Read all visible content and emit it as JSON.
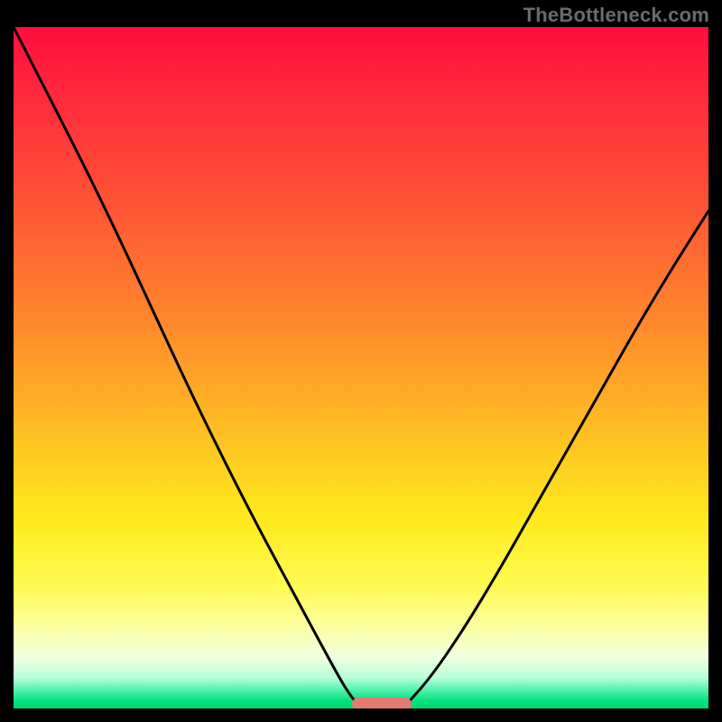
{
  "watermark": {
    "text": "TheBottleneck.com"
  },
  "colors": {
    "frame_bg": "#000000",
    "watermark": "#6b6b6b",
    "curve": "#000000",
    "pill": "#e37b73",
    "gradient_top": "#ff0d3e",
    "gradient_bottom": "#00d870"
  },
  "chart_data": {
    "type": "line",
    "title": "",
    "xlabel": "",
    "ylabel": "",
    "xlim": [
      0,
      100
    ],
    "ylim": [
      0,
      100
    ],
    "grid": false,
    "legend": false,
    "series": [
      {
        "name": "left-curve",
        "x": [
          0,
          5,
          10,
          15,
          20,
          25,
          30,
          35,
          40,
          45,
          48,
          50
        ],
        "values": [
          100,
          90,
          80,
          69.5,
          58.5,
          47.5,
          37,
          27,
          17.5,
          8,
          2.5,
          0
        ]
      },
      {
        "name": "right-curve",
        "x": [
          56,
          60,
          65,
          70,
          75,
          80,
          85,
          90,
          95,
          100
        ],
        "values": [
          0,
          4.5,
          12,
          20.5,
          29.5,
          38.5,
          47.5,
          56.5,
          65,
          73
        ]
      }
    ],
    "annotations": [
      {
        "name": "minimum-pill",
        "x": 53,
        "y": 0.7,
        "width": 8.5
      }
    ],
    "background_gradient": {
      "orientation": "vertical",
      "stops": [
        {
          "pos": 0.0,
          "color": "#ff0d3e"
        },
        {
          "pos": 0.72,
          "color": "#ffe91c"
        },
        {
          "pos": 0.975,
          "color": "#46f0a8"
        },
        {
          "pos": 1.0,
          "color": "#00d870"
        }
      ]
    }
  }
}
